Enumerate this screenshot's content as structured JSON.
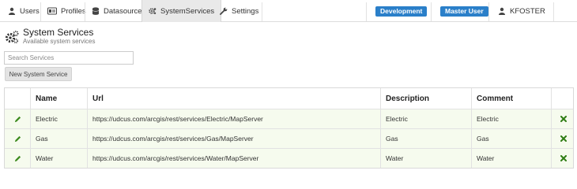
{
  "nav": {
    "items": [
      {
        "label": "Users",
        "icon": "user-icon"
      },
      {
        "label": "Profiles",
        "icon": "id-card-icon"
      },
      {
        "label": "Datasource",
        "icon": "database-icon"
      },
      {
        "label": "SystemServices",
        "icon": "gears-icon",
        "active": true
      },
      {
        "label": "Settings",
        "icon": "wrench-icon"
      }
    ],
    "badges": [
      "Development",
      "Master User"
    ],
    "user": "KFOSTER"
  },
  "header": {
    "title": "System Services",
    "subtitle": "Available system services",
    "icon": "gears-icon"
  },
  "search": {
    "placeholder": "Search Services",
    "value": ""
  },
  "new_button": "New System Service",
  "table": {
    "columns": [
      "Name",
      "Url",
      "Description",
      "Comment"
    ],
    "rows": [
      {
        "name": "Electric",
        "url": "https://udcus.com/arcgis/rest/services/Electric/MapServer",
        "description": "Electric",
        "comment": "Electric"
      },
      {
        "name": "Gas",
        "url": "https://udcus.com/arcgis/rest/services/Gas/MapServer",
        "description": "Gas",
        "comment": "Gas"
      },
      {
        "name": "Water",
        "url": "https://udcus.com/arcgis/rest/services/Water/MapServer",
        "description": "Water",
        "comment": "Water"
      }
    ]
  },
  "colors": {
    "badge": "#2a7fc9",
    "row_bg": "#f6fbee",
    "edit_icon": "#3c8a1e",
    "delete_icon": "#2f7d14"
  }
}
